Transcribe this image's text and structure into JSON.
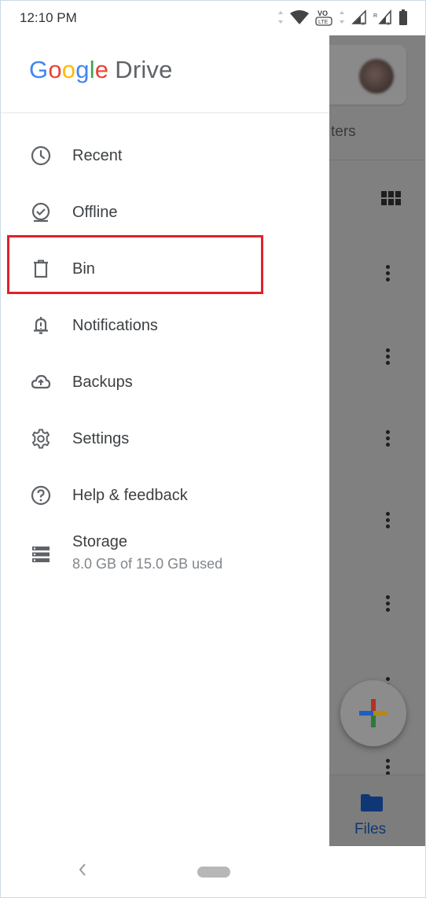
{
  "status_bar": {
    "time": "12:10 PM",
    "icons": [
      "data-arrows-icon",
      "wifi-icon",
      "volte-icon",
      "signal-icon",
      "signal-roaming-icon",
      "battery-icon"
    ]
  },
  "drawer": {
    "logo": {
      "letters": [
        "G",
        "o",
        "o",
        "g",
        "l",
        "e"
      ],
      "product": "Drive"
    },
    "items": [
      {
        "label": "Recent",
        "icon": "clock-icon"
      },
      {
        "label": "Offline",
        "icon": "offline-check-icon"
      },
      {
        "label": "Bin",
        "icon": "trash-icon"
      },
      {
        "label": "Notifications",
        "icon": "bell-icon"
      },
      {
        "label": "Backups",
        "icon": "cloud-upload-icon"
      },
      {
        "label": "Settings",
        "icon": "gear-icon"
      },
      {
        "label": "Help & feedback",
        "icon": "help-icon"
      }
    ],
    "storage": {
      "label": "Storage",
      "usage": "8.0 GB of 15.0 GB used",
      "icon": "storage-icon"
    }
  },
  "background_app": {
    "filters_partial": "ters",
    "bottom_nav": {
      "files_label": "Files"
    }
  },
  "colors": {
    "highlight": "#e1202c",
    "google_blue": "#4285f4",
    "google_red": "#ea4335",
    "google_yellow": "#fbbc05",
    "google_green": "#34a853"
  }
}
